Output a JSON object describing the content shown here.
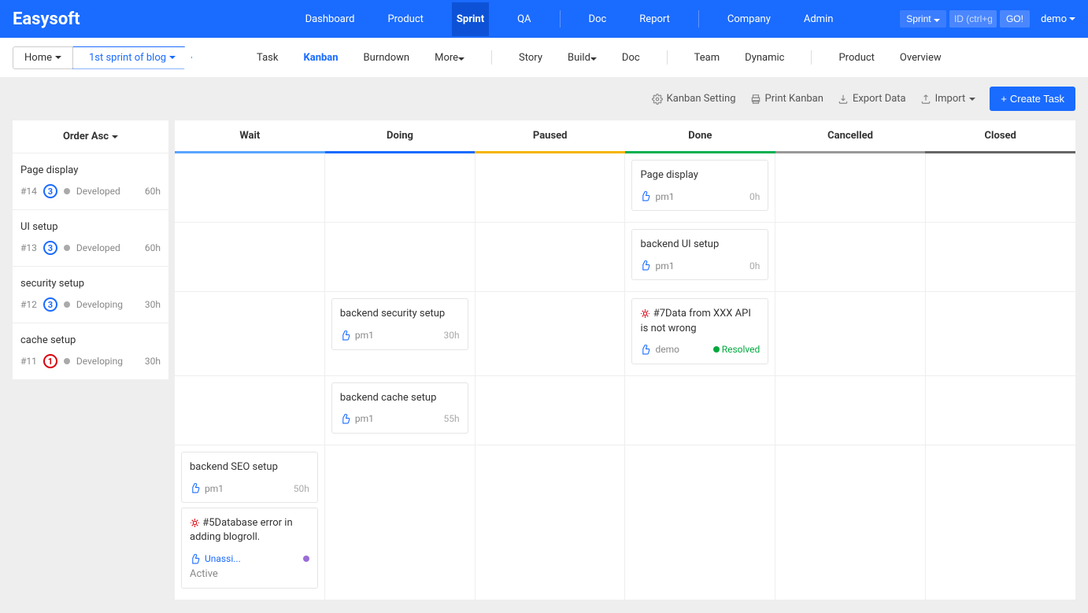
{
  "header": {
    "logo": "Easysoft",
    "nav": [
      "Dashboard",
      "Product",
      "Sprint",
      "QA",
      "Doc",
      "Report",
      "Company",
      "Admin"
    ],
    "activeNav": "Sprint",
    "scopeSelect": "Sprint",
    "searchPlaceholder": "ID (ctrl+g)",
    "goLabel": "GO!",
    "user": "demo"
  },
  "subnav": {
    "breadcrumb": [
      "Home",
      "1st sprint of blog"
    ],
    "items": [
      "Task",
      "Kanban",
      "Burndown",
      "More",
      "Story",
      "Build",
      "Doc",
      "Team",
      "Dynamic",
      "Product",
      "Overview"
    ],
    "activeItem": "Kanban"
  },
  "toolbar": {
    "setting": "Kanban Setting",
    "print": "Print Kanban",
    "export": "Export Data",
    "import": "Import",
    "create": "Create Task"
  },
  "board": {
    "sortLabel": "Order Asc",
    "columns": [
      "Wait",
      "Doing",
      "Paused",
      "Done",
      "Cancelled",
      "Closed"
    ],
    "rows": [
      {
        "title": "Page display",
        "id": "#14",
        "priority": "3",
        "priorityClass": "pri-3",
        "status": "Developed",
        "hours": "60h",
        "cards": {
          "done": [
            {
              "type": "task",
              "title": "Page display",
              "user": "pm1",
              "hours": "0h"
            }
          ]
        }
      },
      {
        "title": "UI setup",
        "id": "#13",
        "priority": "3",
        "priorityClass": "pri-3",
        "status": "Developed",
        "hours": "60h",
        "cards": {
          "done": [
            {
              "type": "task",
              "title": "backend UI setup",
              "user": "pm1",
              "hours": "0h"
            }
          ]
        }
      },
      {
        "title": "security setup",
        "id": "#12",
        "priority": "3",
        "priorityClass": "pri-3",
        "status": "Developing",
        "hours": "30h",
        "cards": {
          "doing": [
            {
              "type": "task",
              "title": "backend security setup",
              "user": "pm1",
              "hours": "30h"
            }
          ],
          "done": [
            {
              "type": "bug",
              "title": "#7Data from XXX API is not wrong",
              "user": "demo",
              "statusText": "Resolved"
            }
          ]
        }
      },
      {
        "title": "cache setup",
        "id": "#11",
        "priority": "1",
        "priorityClass": "pri-1",
        "status": "Developing",
        "hours": "30h",
        "cards": {
          "doing": [
            {
              "type": "task",
              "title": "backend cache setup",
              "user": "pm1",
              "hours": "55h"
            }
          ]
        }
      },
      {
        "title": "",
        "id": "",
        "priority": "",
        "priorityClass": "",
        "status": "",
        "hours": "",
        "hideSide": true,
        "cards": {
          "wait": [
            {
              "type": "task",
              "title": "backend SEO setup",
              "user": "pm1",
              "hours": "50h"
            },
            {
              "type": "bug",
              "title": "#5Database error in adding blogroll.",
              "unassigned": "Unassi...",
              "activeText": "Active"
            }
          ]
        }
      }
    ]
  }
}
